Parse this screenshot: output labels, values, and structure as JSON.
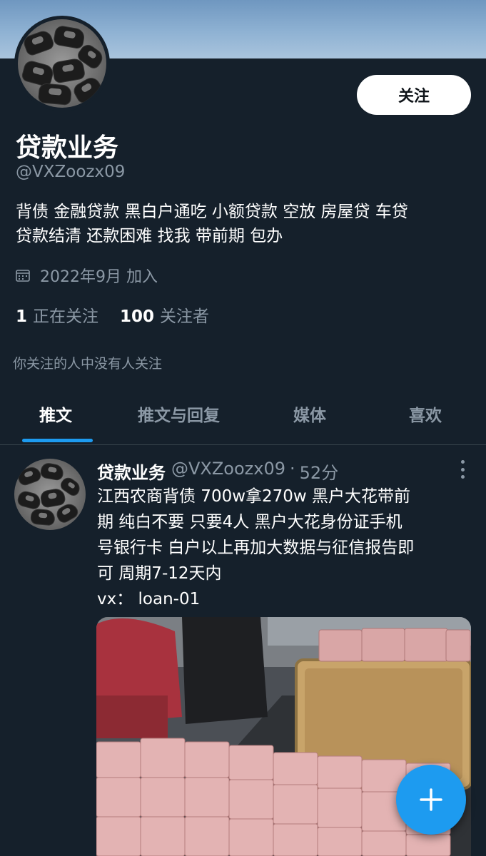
{
  "profile": {
    "name": "贷款业务",
    "handle": "@VXZoozx09",
    "follow_label": "关注",
    "bio_line1": "背债 金融贷款 黑白户通吃 小额贷款 空放 房屋贷 车贷",
    "bio_line2": "贷款结清 还款困难 找我 带前期 包办",
    "joined": "2022年9月 加入",
    "following_count": "1",
    "following_label": "正在关注",
    "followers_count": "100",
    "followers_label": "关注者",
    "followed_by_note": "你关注的人中没有人关注"
  },
  "tabs": [
    {
      "label": "推文",
      "active": true
    },
    {
      "label": "推文与回复",
      "active": false
    },
    {
      "label": "媒体",
      "active": false
    },
    {
      "label": "喜欢",
      "active": false
    }
  ],
  "tweet": {
    "author_name": "贷款业务",
    "author_handle": "@VXZoozx09",
    "separator": "·",
    "time": "52分",
    "text_lines": [
      "江西农商背债  700w拿270w  黑户大花带前",
      "期  纯白不要   只要4人   黑户大花身份证手机",
      "号银行卡   白户以上再加大数据与征信报告即",
      "可  周期7-12天内",
      "vx：  loan-01"
    ]
  },
  "icons": {
    "calendar": "calendar-icon",
    "more": "more-vertical-icon",
    "compose": "plus-icon"
  },
  "colors": {
    "background": "#15202b",
    "accent": "#1d9bf0",
    "muted_text": "#8b98a5"
  }
}
